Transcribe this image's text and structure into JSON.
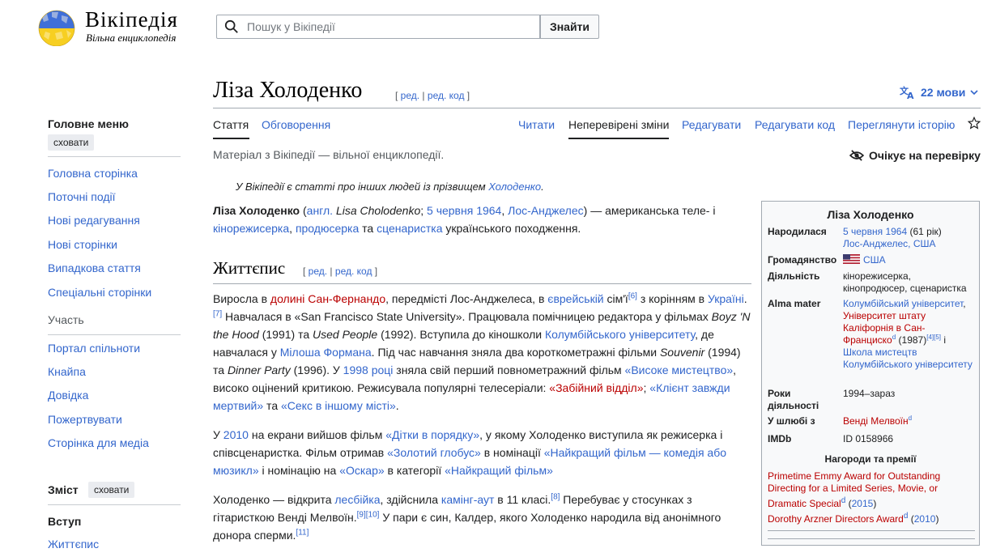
{
  "header": {
    "wordmark": "Вікіпедія",
    "tagline": "Вільна енциклопедія",
    "search_placeholder": "Пошук у Вікіпедії",
    "search_button": "Знайти"
  },
  "sidebar": {
    "main_menu_title": "Головне меню",
    "hide_label": "сховати",
    "items": [
      "Головна сторінка",
      "Поточні події",
      "Нові редагування",
      "Нові сторінки",
      "Випадкова стаття",
      "Спеціальні сторінки"
    ],
    "participation_label": "Участь",
    "items2": [
      "Портал спільноти",
      "Кнайпа",
      "Довідка",
      "Пожертвувати",
      "Сторінка для медіа"
    ],
    "toc_title": "Зміст",
    "toc_hide": "сховати",
    "toc_items": [
      "Вступ",
      "Життєпис"
    ]
  },
  "page": {
    "title": "Ліза Холоденко",
    "edit": "ред.",
    "edit_code": "ред. код",
    "languages": "22 мови",
    "tabs": {
      "article": "Стаття",
      "talk": "Обговорення",
      "read": "Читати",
      "unchecked": "Неперевірені зміни",
      "edit": "Редагувати",
      "edit_code": "Редагувати код",
      "history": "Переглянути історію"
    },
    "from": "Матеріал з Вікіпедії — вільної енциклопедії.",
    "pending": "Очікує на перевірку",
    "hatnote": {
      "text": "У Вікіпедії є статті про інших людей із прізвищем ",
      "link": "Холоденко",
      "end": "."
    },
    "lead": {
      "name": "Ліза Холоденко",
      "p1": " (",
      "eng": "англ.",
      "orig": "Lisa Cholodenko",
      "sep": "; ",
      "date": "5 червня 1964",
      "comma": ", ",
      "place": "Лос-Анджелес",
      "t1": ") — американська теле- і ",
      "l1": "кінорежисерка",
      "l2": "продюсерка",
      "t2": " та ",
      "l3": "сценаристка",
      "t3": " українського походження."
    },
    "section": "Життєпис",
    "bio1": {
      "a": "Виросла в ",
      "valley": "долині Сан-Фернандо",
      "b": ", передмісті Лос-Анджелеса, в ",
      "jewish": "єврейській",
      "c": " сім'ї",
      "r6": "[6]",
      "d": " з корінням в ",
      "ukraine": "Україні",
      "e": ".",
      "r7": "[7]",
      "f": " Навчалася в «San Francisco State University». Працювала помічницею редактора у фільмах ",
      "boyz": "Boyz 'N the Hood",
      "g": " (1991) та ",
      "used": "Used People",
      "h": " (1992). Вступила до кіношколи ",
      "columbia": "Колумбійського університету",
      "i": ", де навчалася у ",
      "forman": "Мілоша Формана",
      "j": ". Під час навчання зняла два короткометражні фільми ",
      "souvenir": "Souvenir",
      "k": " (1994) та ",
      "dinner": "Dinner Party",
      "l": " (1996). У ",
      "y1998": "1998 році",
      "m": " зняла свій перший повнометражний фільм ",
      "high": "«Високе мистецтво»",
      "n": ", високо оцінений критикою. Режисувала популярні телесеріали: ",
      "murder": "«Забійний відділ»",
      "o": "; ",
      "dead": "«Клієнт завжди мертвий»",
      "p": " та ",
      "sex": "«Секс в іншому місті»",
      "q": "."
    },
    "bio2": {
      "a": "У ",
      "y2010": "2010",
      "b": " на екрани вийшов фільм ",
      "kids": "«Дітки в порядку»",
      "c": ", у якому Холоденко виступила як режисерка і співсценаристка. Фільм отримав ",
      "globe": "«Золотий глобус»",
      "d": " в номінації ",
      "best_comedy": "«Найкращий фільм — комедія або мюзикл»",
      "e": " і номінацію на ",
      "oscar": "«Оскар»",
      "f": " в категорії ",
      "best": "«Найкращий фільм»"
    },
    "bio3": {
      "a": "Холоденко — відкрита ",
      "lesbian": "лесбійка",
      "b": ", здійснила ",
      "comingout": "камінг-аут",
      "c": " в 11 класі.",
      "r8": "[8]",
      "d": " Перебуває у стосунках з гітаристкою Венді Мелвоїн.",
      "r9": "[9]",
      "r10": "[10]",
      "e": " У пари є син, Калдер, якого Холоденко народила від анонімного донора сперми.",
      "r11": "[11]"
    }
  },
  "infobox": {
    "title": "Ліза Холоденко",
    "born_label": "Народилася",
    "born_date": "5 червня 1964",
    "born_age": " (61 рік)",
    "born_place": "Лос-Анджелес, США",
    "citizenship_label": "Громадянство",
    "citizenship": "США",
    "occupation_label": "Діяльність",
    "occupation": "кінорежисерка, кінопродюсер, сценаристка",
    "alma_label": "Alma mater",
    "alma1": "Колумбійський університет",
    "alma2": "Університет штату Каліфорнія в Сан-Франциско",
    "alma2_sup": "d",
    "alma2_year": " (1987)",
    "alma2_refs": "[4][5]",
    "alma_and": " і",
    "alma3": "Школа мистецтв Колумбійського університету",
    "years_label": "Роки діяльності",
    "years": "1994–зараз",
    "spouse_label": "У шлюбі з",
    "spouse": "Венді Мелвоїн",
    "spouse_sup": "d",
    "imdb_label": "IMDb",
    "imdb": "ID 0158966",
    "awards_title": "Нагороди та премії",
    "award1": "Primetime Emmy Award for Outstanding Directing for a Limited Series, Movie, or Dramatic Special",
    "award1_sup": "d",
    "award1_year_open": " (",
    "award1_year": "2015",
    "award1_year_close": ")",
    "award2": "Dorothy Arzner Directors Award",
    "award2_sup": "d",
    "award2_year_open": " (",
    "award2_year": "2010",
    "award2_year_close": ")"
  },
  "colors": {
    "link": "#3366cc",
    "redlink": "#ba0000",
    "text": "#202122"
  }
}
